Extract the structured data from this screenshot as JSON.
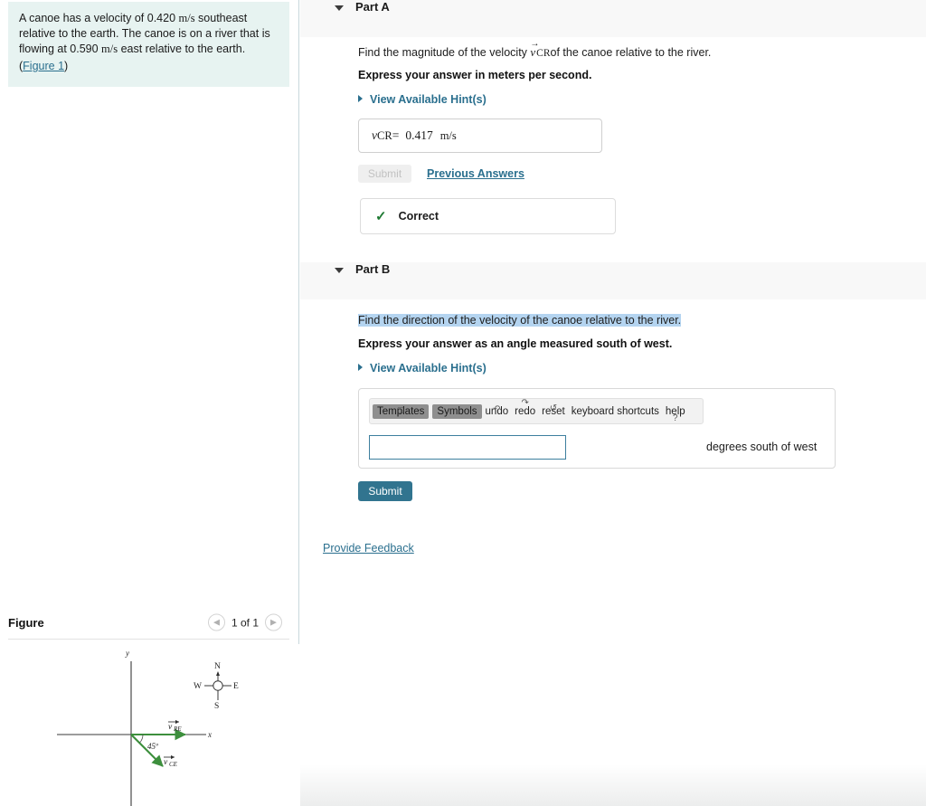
{
  "problem": {
    "line1_a": "A canoe has a velocity of 0.420 ",
    "line1_unit": "m/s",
    "line1_b": " southeast",
    "line2": "relative to the earth. The canoe is on a river that",
    "line3_a": "is flowing at 0.590 ",
    "line3_unit": "m/s",
    "line3_b": " east relative to the earth.",
    "figure_link_open": "(",
    "figure_link": "Figure 1",
    "figure_link_close": ")"
  },
  "figure_panel": {
    "title": "Figure",
    "prev_icon": "chevron-left-icon",
    "count": "1 of 1",
    "next_icon": "chevron-right-icon",
    "diagram": {
      "x_axis_label": "x",
      "y_axis_label": "y",
      "angle_label": "45º",
      "vector_river_label": "v",
      "vector_river_sub": "RE",
      "vector_canoe_label": "v",
      "vector_canoe_sub": "CE",
      "compass_n": "N",
      "compass_s": "S",
      "compass_e": "E",
      "compass_w": "W",
      "vector_color": "#3d8f3d",
      "axis_color": "#3a3a3a"
    }
  },
  "part_a": {
    "caret_icon": "caret-down-icon",
    "label": "Part A",
    "question_pre": "Find the magnitude of the velocity ",
    "question_vec": "v",
    "question_vec_sub": "CR",
    "question_post": "of the canoe relative to the river.",
    "instruction": "Express your answer in meters per second.",
    "hints_label": "View Available Hint(s)",
    "answer_var": "v",
    "answer_var_sub": "CR",
    "answer_eq": "=",
    "answer_value": "0.417",
    "answer_unit": "m/s",
    "submit_label": "Submit",
    "previous_answers_label": "Previous Answers",
    "status_icon": "checkmark-icon",
    "status_label": "Correct",
    "status_color": "#1f7a33"
  },
  "part_b": {
    "caret_icon": "caret-down-icon",
    "label": "Part B",
    "question": "Find the direction of the velocity of the canoe relative to the river.",
    "instruction": "Express your answer as an angle measured south of west.",
    "hints_label": "View Available Hint(s)",
    "toolbar": [
      {
        "label": "Templates",
        "type": "button",
        "glyph": "□",
        "name": "templates-button"
      },
      {
        "label": "Symbols",
        "type": "button",
        "glyph": "",
        "name": "symbols-button"
      },
      {
        "label": "undo",
        "type": "item",
        "glyph": "↶",
        "name": "undo-button"
      },
      {
        "label": "redo",
        "type": "item",
        "glyph": "↷",
        "name": "redo-button"
      },
      {
        "label": "reset",
        "type": "item",
        "glyph": "↺",
        "name": "reset-button"
      },
      {
        "label": "keyboard shortcuts",
        "type": "item",
        "glyph": "",
        "name": "keyboard-shortcuts-button"
      },
      {
        "label": "help",
        "type": "item",
        "glyph": "?",
        "name": "help-button"
      }
    ],
    "answer_value": "",
    "answer_placeholder": "",
    "unit_label": "degrees south of west",
    "submit_label": "Submit"
  },
  "footer": {
    "feedback_label": "Provide Feedback"
  },
  "colors": {
    "accent_blue": "#2a6f8e",
    "submit_blue": "#31748f",
    "problem_bg": "#e7f3f1",
    "header_bg": "#f8f8f8",
    "selection_bg": "#b4d4f0"
  }
}
